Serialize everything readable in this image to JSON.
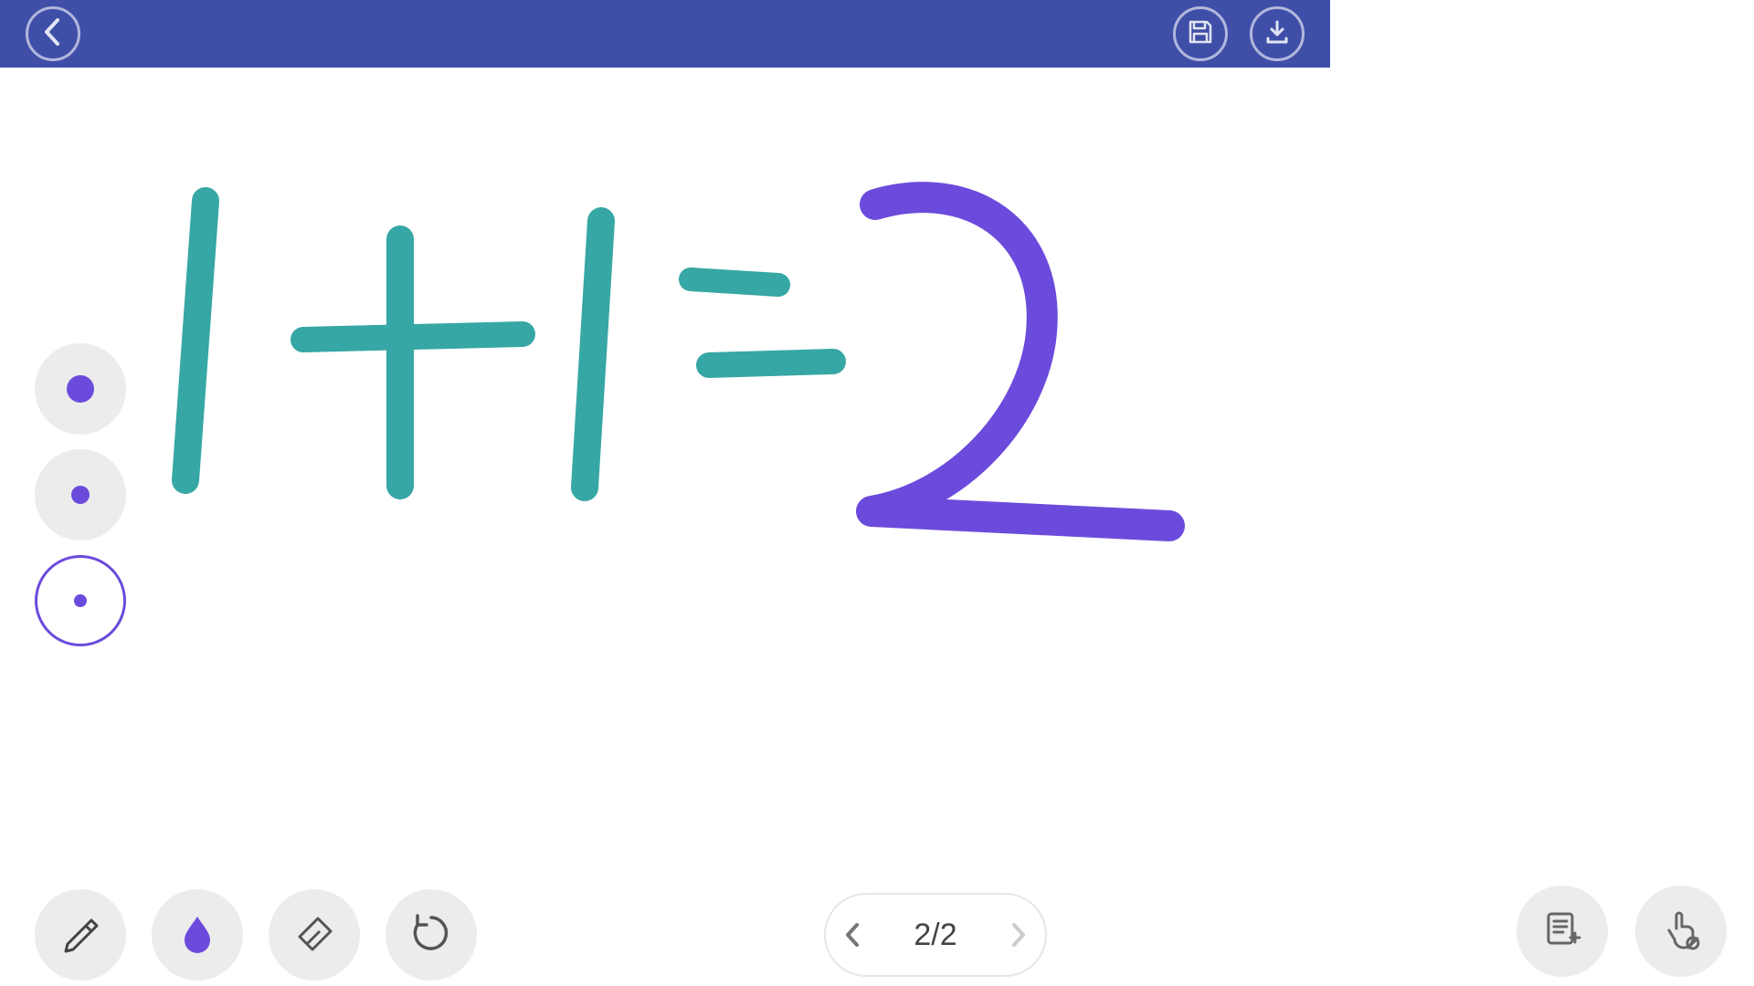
{
  "colors": {
    "accent": "#6B4BDC",
    "teal": "#36A7A5",
    "topbar": "#3F4FA8",
    "tool_bg": "#ECECEC"
  },
  "drawing": {
    "equation_parts": [
      "1",
      "+",
      "1",
      "=",
      "2"
    ],
    "colors": {
      "left": "teal",
      "answer": "accent"
    }
  },
  "stroke_sizes": {
    "labels": [
      "large",
      "medium",
      "small"
    ],
    "selected_index": 2
  },
  "tools": {
    "items": [
      {
        "id": "pen",
        "icon": "pen-icon"
      },
      {
        "id": "color",
        "icon": "drop-icon",
        "active": true
      },
      {
        "id": "eraser",
        "icon": "eraser-icon"
      },
      {
        "id": "undo",
        "icon": "undo-icon"
      }
    ]
  },
  "pager": {
    "current": 2,
    "total": 2,
    "label": "2/2"
  },
  "top_actions": {
    "back": {
      "icon": "chevron-left-icon"
    },
    "save": {
      "icon": "save-icon"
    },
    "download": {
      "icon": "download-icon"
    }
  },
  "bottom_right": {
    "new_note": {
      "icon": "new-note-icon"
    },
    "gesture": {
      "icon": "touch-off-icon"
    }
  }
}
